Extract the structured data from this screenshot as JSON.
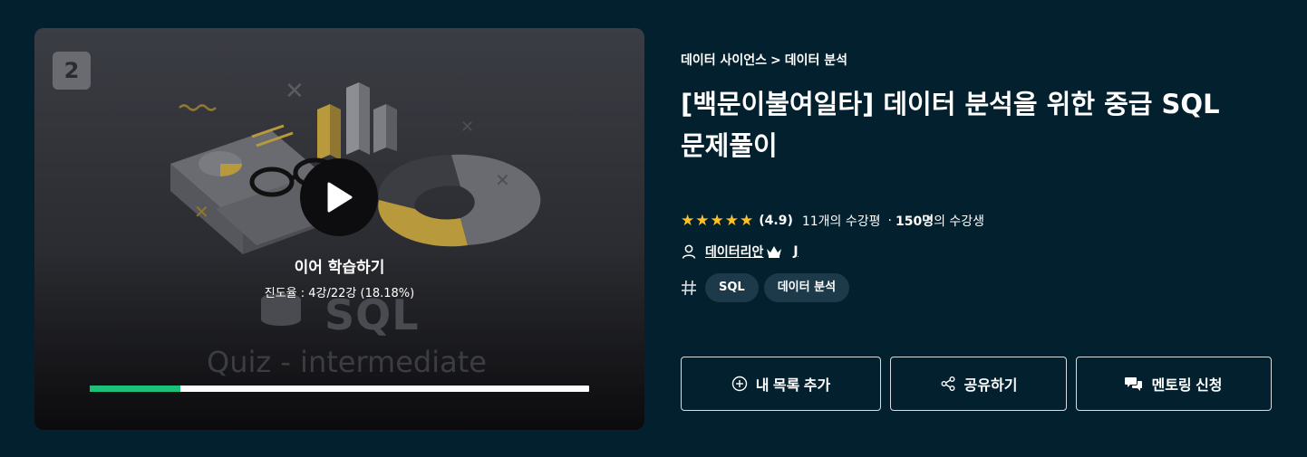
{
  "video": {
    "lecture_badge": "2",
    "thumb_sql": "SQL",
    "thumb_subtitle": "Quiz - intermediate",
    "resume_label": "이어 학습하기",
    "progress_text": "진도율 : 4강/22강 (18.18%)",
    "progress_fraction": 0.1818,
    "progress_color": "#1dc078"
  },
  "breadcrumb": {
    "parent": "데이터 사이언스",
    "separator": ">",
    "child": "데이터 분석"
  },
  "course": {
    "title_line1": "[백문이불여일타] 데이터 분석을 위한 중급 SQL",
    "title_line2": "문제풀이"
  },
  "rating": {
    "star_count": 5,
    "star_color": "#ffc023",
    "score": "(4.9)",
    "reviews": "11개의 수강평",
    "dot": "·",
    "students_bold": "150명",
    "students_suffix": "의 수강생"
  },
  "instructor": {
    "name": "데이터리안",
    "extra": "J"
  },
  "tags": [
    "SQL",
    "데이터 분석"
  ],
  "actions": {
    "wishlist": "내 목록 추가",
    "share": "공유하기",
    "mentoring": "멘토링 신청"
  },
  "icons": {
    "play": "play-icon",
    "user": "user-icon",
    "crown": "crown-icon",
    "hash": "hash-icon",
    "plus": "plus-circle-icon",
    "share": "share-icon",
    "chat": "chat-icon"
  }
}
